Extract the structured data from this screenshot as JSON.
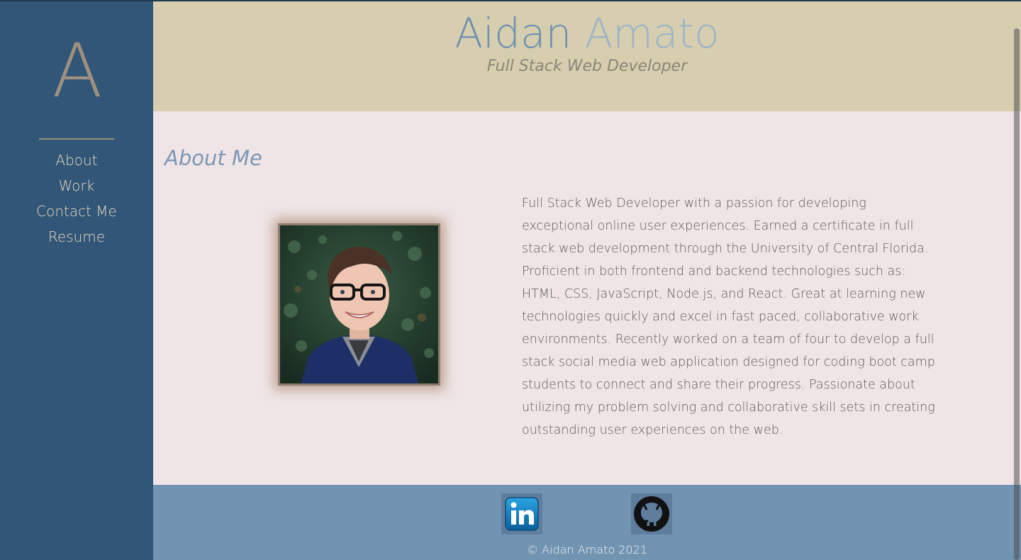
{
  "sidebar": {
    "logo": "A",
    "nav": [
      "About",
      "Work",
      "Contact Me",
      "Resume"
    ]
  },
  "header": {
    "first_name": "Aidan",
    "last_name": "Amato",
    "subtitle": "Full Stack Web Developer"
  },
  "main": {
    "section_title": "About Me",
    "about_text": "Full Stack Web Developer with a passion for developing exceptional online user experiences. Earned a certificate in full stack web development through the University of Central Florida. Proficient in both frontend and backend technologies such as: HTML, CSS, JavaScript, Node.js, and React. Great at learning new technologies quickly and excel in fast paced, collaborative work environments. Recently worked on a team of four to develop a full stack social media web application designed for coding boot camp students to connect and share their progress. Passionate about utilizing my problem solving and collaborative skill sets in creating outstanding user experiences on the web."
  },
  "footer": {
    "copyright": "© Aidan Amato 2021",
    "social_icons": [
      "linkedin-icon",
      "github-icon"
    ]
  },
  "colors": {
    "sidebar_bg": "#325677",
    "header_bg": "#d6ceae",
    "main_bg": "#efe5e6",
    "footer_bg": "#7294b3",
    "accent_blue": "#6f90b2",
    "accent_tan": "#9e8f7e"
  }
}
